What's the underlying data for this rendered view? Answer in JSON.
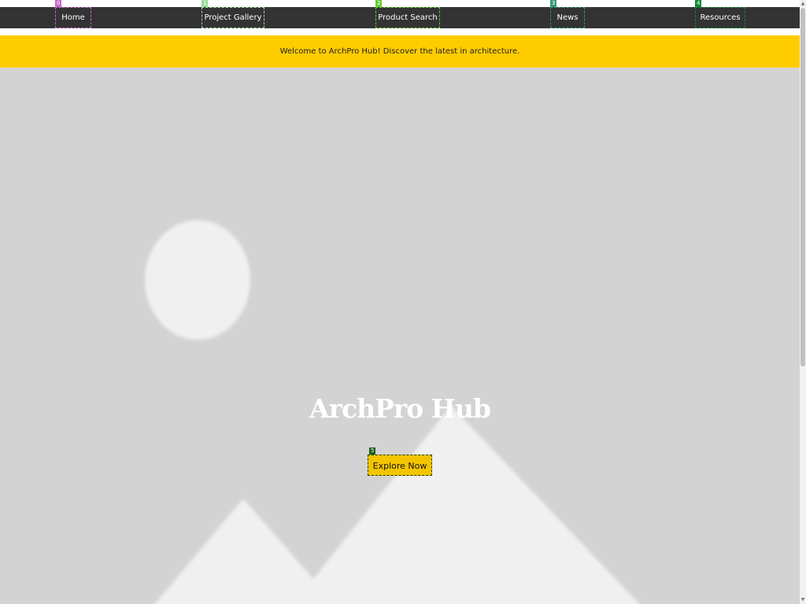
{
  "nav": {
    "items": [
      {
        "label": "Home",
        "tag": "0",
        "color": "#cc66cc"
      },
      {
        "label": "Project Gallery",
        "tag": "1",
        "color": "#99dd99"
      },
      {
        "label": "Product Search",
        "tag": "2",
        "color": "#66cc33"
      },
      {
        "label": "News",
        "tag": "3",
        "color": "#339977"
      },
      {
        "label": "Resources",
        "tag": "4",
        "color": "#118833"
      }
    ]
  },
  "banner": {
    "text": "Welcome to ArchPro Hub! Discover the latest in architecture."
  },
  "hero": {
    "title": "ArchPro Hub",
    "cta_label": "Explore Now",
    "cta_tag": "5",
    "image_icon": "image-placeholder-icon"
  },
  "colors": {
    "nav_background": "#333333",
    "banner_background": "#ffcc00",
    "hero_background": "#d3d3d3",
    "cta_background": "#f5c400"
  }
}
